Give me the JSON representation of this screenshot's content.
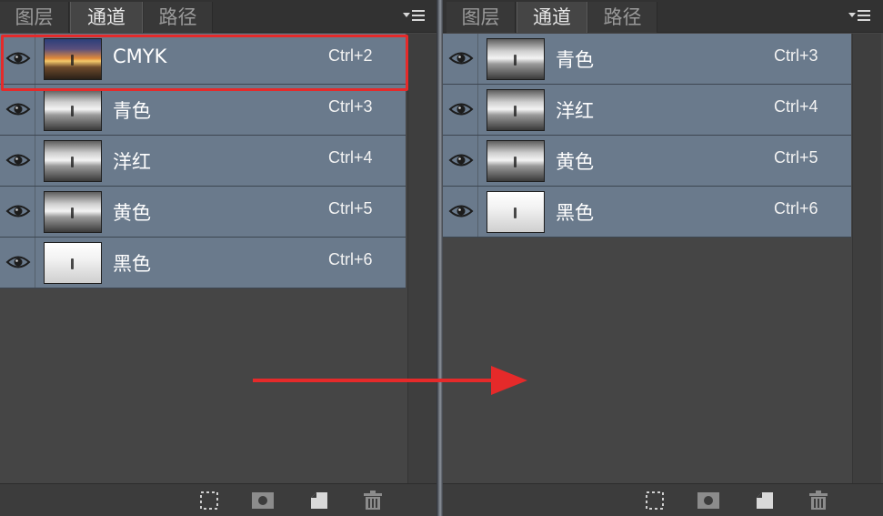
{
  "left_panel": {
    "tabs": [
      {
        "label": "图层",
        "active": false
      },
      {
        "label": "通道",
        "active": true
      },
      {
        "label": "路径",
        "active": false
      }
    ],
    "channels": [
      {
        "name": "CMYK",
        "shortcut": "Ctrl+2",
        "thumb": "color"
      },
      {
        "name": "青色",
        "shortcut": "Ctrl+3",
        "thumb": "gray"
      },
      {
        "name": "洋红",
        "shortcut": "Ctrl+4",
        "thumb": "gray"
      },
      {
        "name": "黄色",
        "shortcut": "Ctrl+5",
        "thumb": "gray"
      },
      {
        "name": "黑色",
        "shortcut": "Ctrl+6",
        "thumb": "light"
      }
    ]
  },
  "right_panel": {
    "tabs": [
      {
        "label": "图层",
        "active": false
      },
      {
        "label": "通道",
        "active": true
      },
      {
        "label": "路径",
        "active": false
      }
    ],
    "channels": [
      {
        "name": "青色",
        "shortcut": "Ctrl+3",
        "thumb": "gray"
      },
      {
        "name": "洋红",
        "shortcut": "Ctrl+4",
        "thumb": "gray"
      },
      {
        "name": "黄色",
        "shortcut": "Ctrl+5",
        "thumb": "gray"
      },
      {
        "name": "黑色",
        "shortcut": "Ctrl+6",
        "thumb": "light"
      }
    ]
  },
  "footer_icons": [
    "load-selection-icon",
    "save-selection-mask-icon",
    "new-channel-icon",
    "delete-channel-icon"
  ],
  "colors": {
    "row_bg": "#6a7a8c",
    "panel_bg": "#454545",
    "highlight": "#e52a2a",
    "arrow": "#e52a2a"
  }
}
